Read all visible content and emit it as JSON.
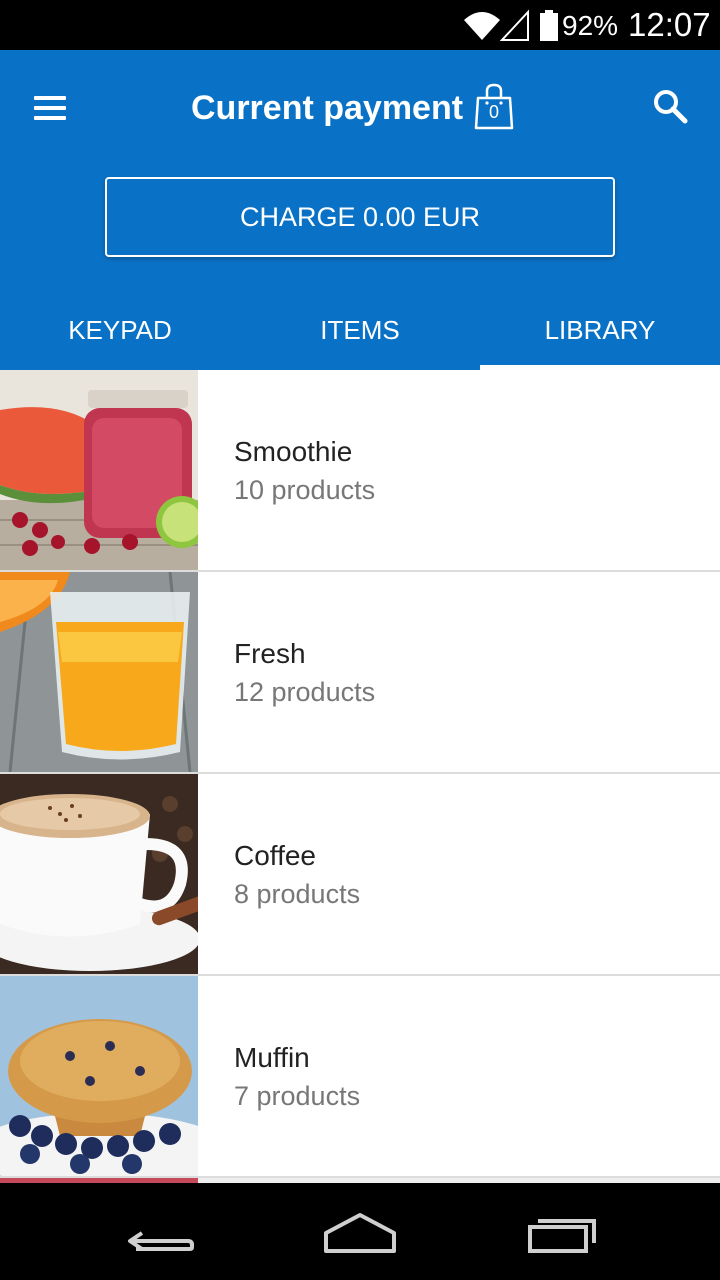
{
  "status_bar": {
    "battery_percent": "92%",
    "time": "12:07",
    "icons": [
      "wifi-icon",
      "signal-icon",
      "battery-icon"
    ]
  },
  "app_bar": {
    "title": "Current payment",
    "cart_count": "0",
    "charge_label": "CHARGE 0.00 EUR",
    "icons": [
      "menu-icon",
      "shopping-bag-icon",
      "search-icon"
    ],
    "accent_color": "#0a72c6"
  },
  "tabs": [
    {
      "label": "KEYPAD",
      "active": false
    },
    {
      "label": "ITEMS",
      "active": false
    },
    {
      "label": "LIBRARY",
      "active": true
    }
  ],
  "library": [
    {
      "name": "Smoothie",
      "count": "10 products",
      "image": "smoothie-image"
    },
    {
      "name": "Fresh",
      "count": "12 products",
      "image": "orange-juice-image"
    },
    {
      "name": "Coffee",
      "count": "8 products",
      "image": "coffee-cup-image"
    },
    {
      "name": "Muffin",
      "count": "7 products",
      "image": "muffin-image"
    }
  ],
  "nav_bar": {
    "icons": [
      "back-icon",
      "home-icon",
      "recent-apps-icon"
    ]
  }
}
